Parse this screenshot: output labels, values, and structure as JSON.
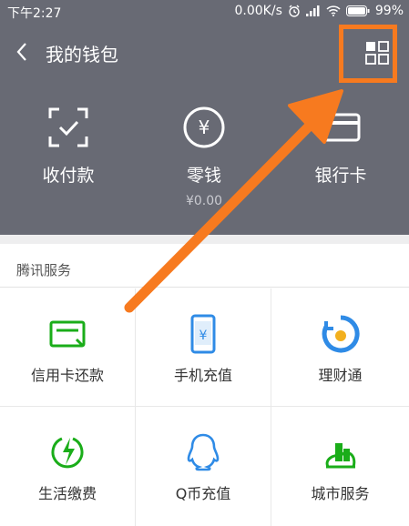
{
  "status": {
    "time": "下午2:27",
    "speed": "0.00K/s",
    "battery": "99%"
  },
  "header": {
    "title": "我的钱包"
  },
  "header_items": [
    {
      "label": "收付款",
      "sub": ""
    },
    {
      "label": "零钱",
      "sub": "¥0.00",
      "icon_glyph": "¥"
    },
    {
      "label": "银行卡",
      "sub": ""
    }
  ],
  "section": {
    "title": "腾讯服务"
  },
  "services": [
    {
      "label": "信用卡还款"
    },
    {
      "label": "手机充值",
      "icon_glyph": "¥"
    },
    {
      "label": "理财通"
    },
    {
      "label": "生活缴费"
    },
    {
      "label": "Q币充值"
    },
    {
      "label": "城市服务"
    }
  ],
  "colors": {
    "header_bg": "#686a74",
    "accent_green": "#1aad19",
    "accent_blue": "#2f8be6",
    "highlight_orange": "#f77a1f"
  }
}
